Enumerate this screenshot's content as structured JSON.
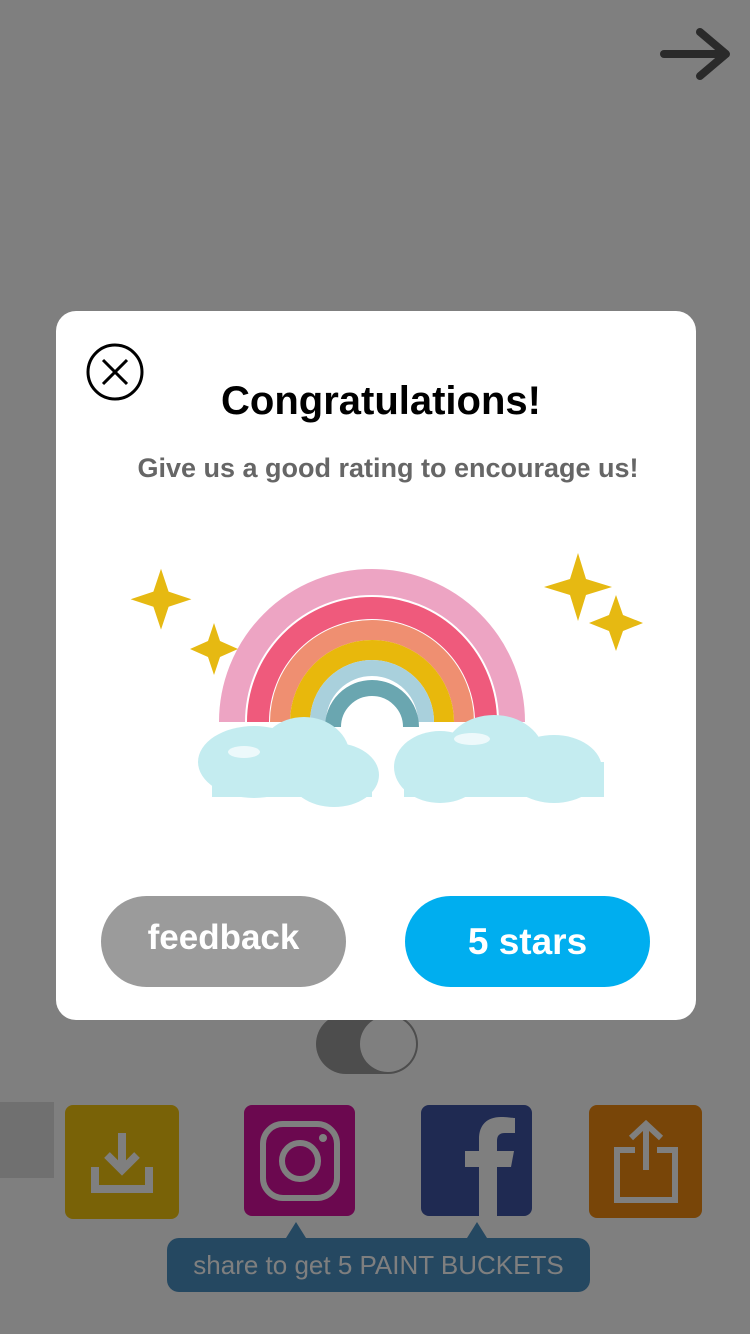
{
  "background": {
    "share_caption": "share to get 5 PAINT BUCKETS",
    "icons": {
      "next": "arrow-right-icon",
      "gallery": "image-icon",
      "video": "clapperboard-icon",
      "download": "download-icon",
      "instagram": "instagram-icon",
      "facebook": "facebook-icon",
      "share": "share-icon"
    },
    "colors": {
      "download": "#f2c40f",
      "instagram": "#d6119e",
      "facebook": "#3e55a5",
      "share": "#f08a11",
      "caption": "#4a90c2"
    }
  },
  "modal": {
    "title": "Congratulations!",
    "subtitle": "Give us a good rating to encourage us!",
    "close_icon": "close-circle-icon",
    "illustration": "pixel-rainbow-with-clouds-and-sparkles",
    "feedback_label": "feedback",
    "stars_label": "5 stars",
    "colors": {
      "feedback_button": "#9b9b9b",
      "stars_button": "#00aeef"
    }
  }
}
